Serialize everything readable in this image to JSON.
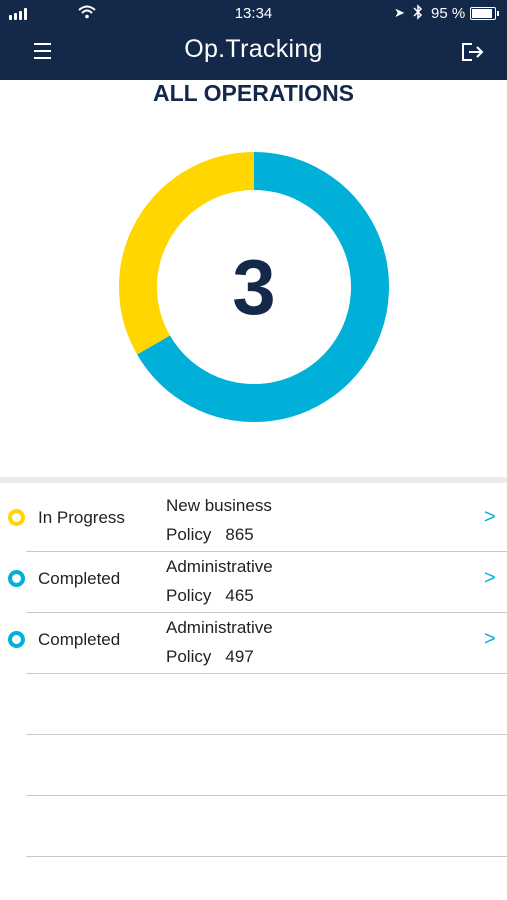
{
  "status_bar": {
    "time": "13:34",
    "battery_percent": "95 %"
  },
  "header": {
    "title": "Op.Tracking"
  },
  "section": {
    "title": "ALL OPERATIONS"
  },
  "chart_data": {
    "type": "donut",
    "total": "3",
    "series": [
      {
        "status": "In Progress",
        "value": 1,
        "color": "#ffd600"
      },
      {
        "status": "Completed",
        "value": 2,
        "color": "#00b0d8"
      }
    ]
  },
  "operations": [
    {
      "status": "In Progress",
      "type": "New business",
      "policy_label": "Policy",
      "policy_number": "865",
      "status_color": "#ffd600",
      "chevron": ">"
    },
    {
      "status": "Completed",
      "type": "Administrative",
      "policy_label": "Policy",
      "policy_number": "465",
      "status_color": "#00b0d8",
      "chevron": ">"
    },
    {
      "status": "Completed",
      "type": "Administrative",
      "policy_label": "Policy",
      "policy_number": "497",
      "status_color": "#00b0d8",
      "chevron": ">"
    }
  ]
}
